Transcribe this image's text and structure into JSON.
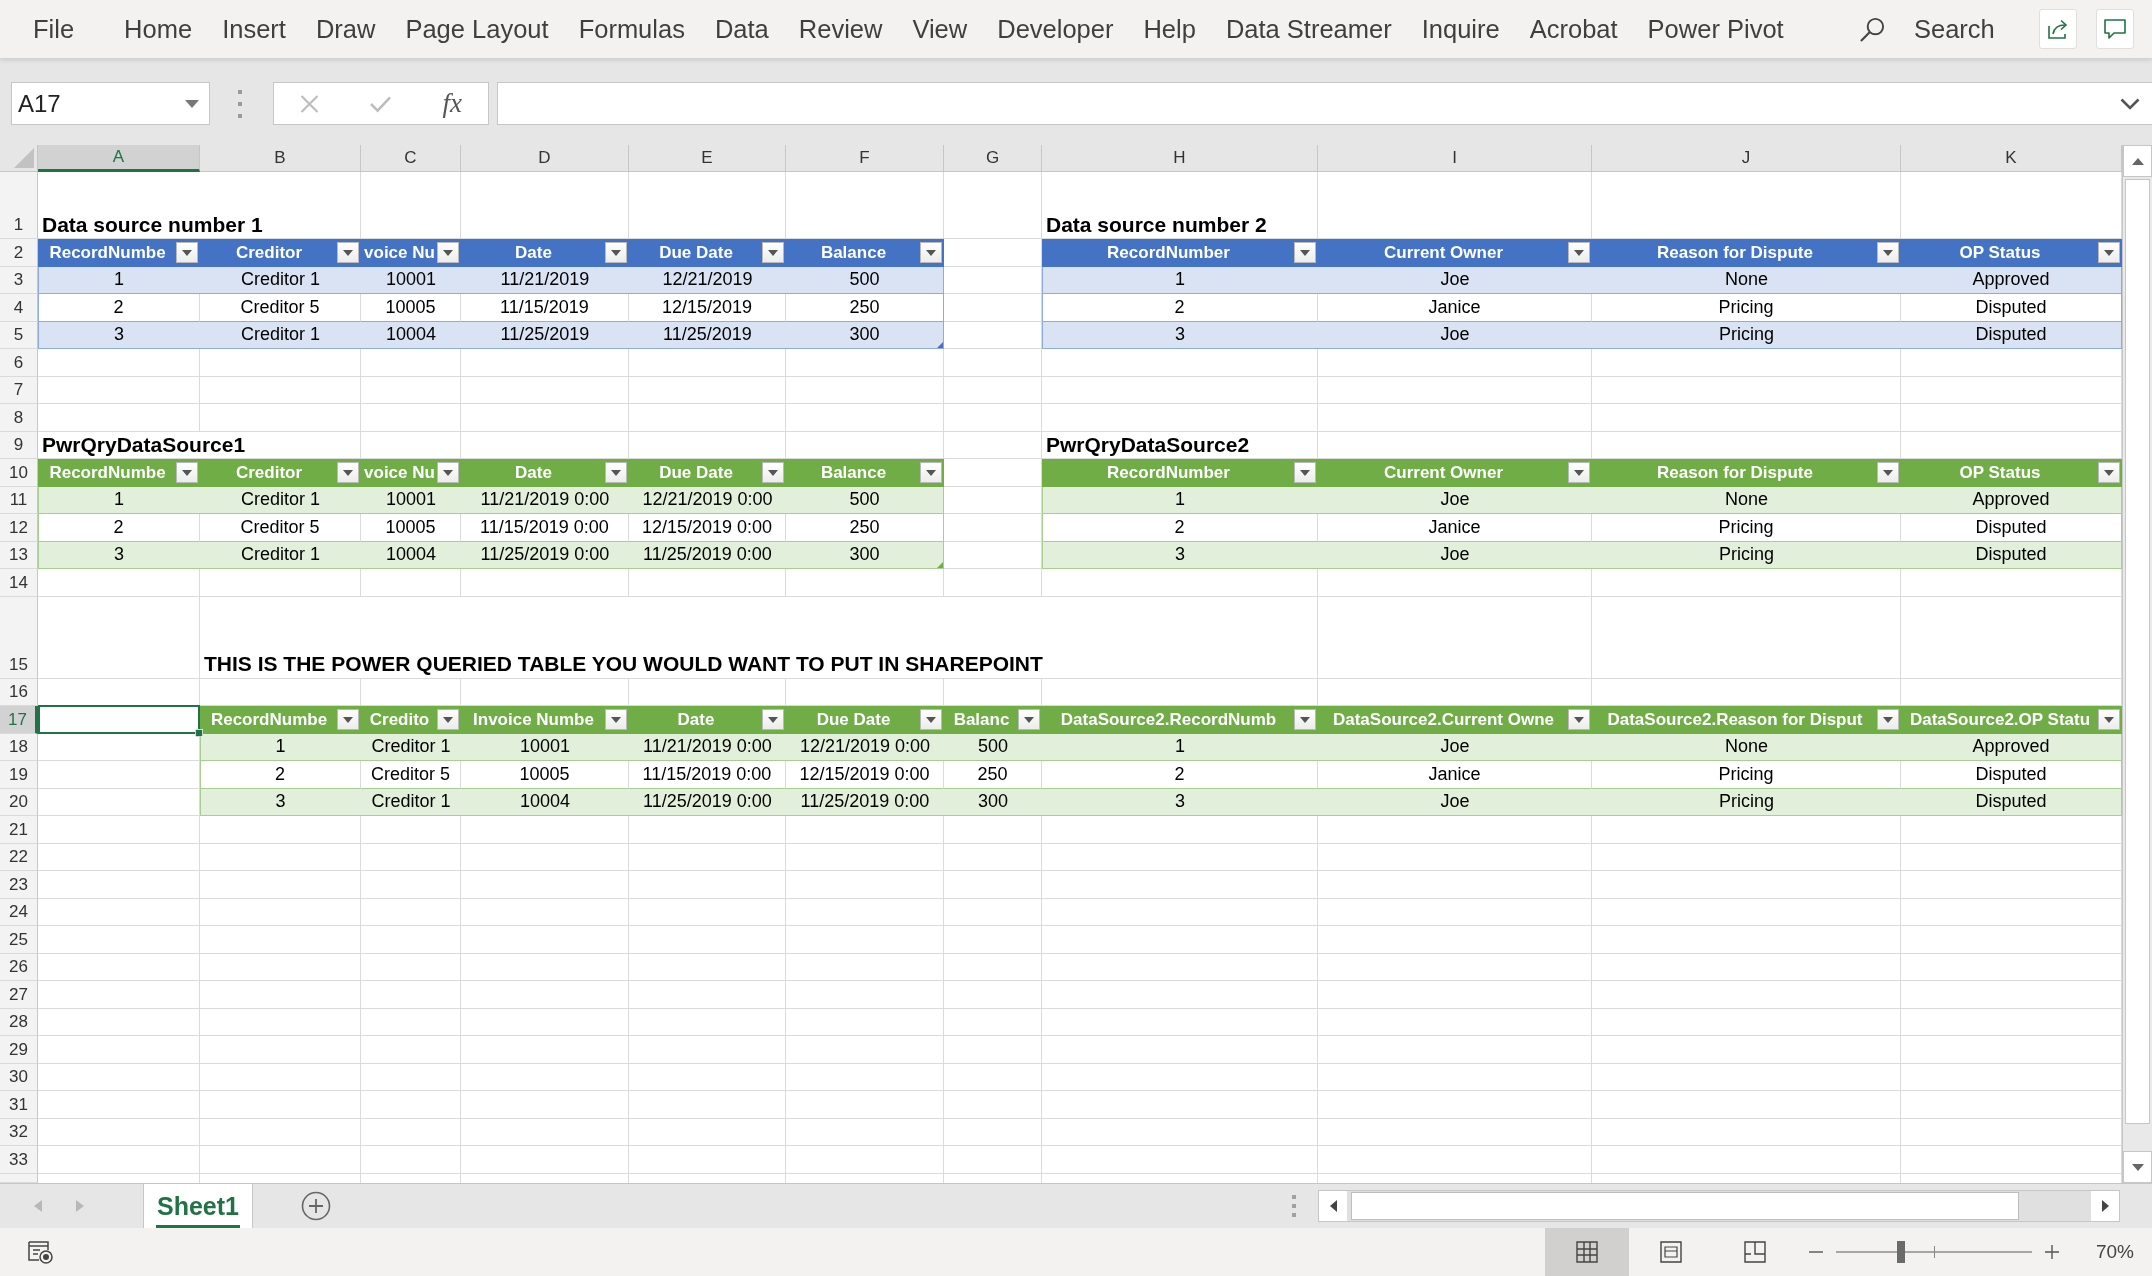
{
  "ribbon": {
    "tabs": [
      {
        "label": "File",
        "selected": false
      },
      {
        "label": "Home",
        "selected": false
      },
      {
        "label": "Insert",
        "selected": false
      },
      {
        "label": "Draw",
        "selected": false
      },
      {
        "label": "Page Layout",
        "selected": false
      },
      {
        "label": "Formulas",
        "selected": false
      },
      {
        "label": "Data",
        "selected": false
      },
      {
        "label": "Review",
        "selected": false
      },
      {
        "label": "View",
        "selected": false
      },
      {
        "label": "Developer",
        "selected": false
      },
      {
        "label": "Help",
        "selected": false
      },
      {
        "label": "Data Streamer",
        "selected": false
      },
      {
        "label": "Inquire",
        "selected": false
      },
      {
        "label": "Acrobat",
        "selected": false
      },
      {
        "label": "Power Pivot",
        "selected": false
      }
    ],
    "search": {
      "placeholder": "Search"
    }
  },
  "formula_bar": {
    "name_box": "A17",
    "function_button": "fx"
  },
  "sheet": {
    "columns": [
      {
        "label": "A",
        "selected": true
      },
      {
        "label": "B",
        "selected": false
      },
      {
        "label": "C",
        "selected": false
      },
      {
        "label": "D",
        "selected": false
      },
      {
        "label": "E",
        "selected": false
      },
      {
        "label": "F",
        "selected": false
      },
      {
        "label": "G",
        "selected": false
      },
      {
        "label": "H",
        "selected": false
      },
      {
        "label": "I",
        "selected": false
      },
      {
        "label": "J",
        "selected": false
      },
      {
        "label": "K",
        "selected": false
      }
    ],
    "rows": [
      {
        "label": "1",
        "selected": false
      },
      {
        "label": "2",
        "selected": false
      },
      {
        "label": "3",
        "selected": false
      },
      {
        "label": "4",
        "selected": false
      },
      {
        "label": "5",
        "selected": false
      },
      {
        "label": "6",
        "selected": false
      },
      {
        "label": "7",
        "selected": false
      },
      {
        "label": "8",
        "selected": false
      },
      {
        "label": "9",
        "selected": false
      },
      {
        "label": "10",
        "selected": false
      },
      {
        "label": "11",
        "selected": false
      },
      {
        "label": "12",
        "selected": false
      },
      {
        "label": "13",
        "selected": false
      },
      {
        "label": "14",
        "selected": false
      },
      {
        "label": "15",
        "selected": false
      },
      {
        "label": "16",
        "selected": false
      },
      {
        "label": "17",
        "selected": true
      },
      {
        "label": "18",
        "selected": false
      },
      {
        "label": "19",
        "selected": false
      },
      {
        "label": "20",
        "selected": false
      },
      {
        "label": "21",
        "selected": false
      },
      {
        "label": "22",
        "selected": false
      },
      {
        "label": "23",
        "selected": false
      },
      {
        "label": "24",
        "selected": false
      },
      {
        "label": "25",
        "selected": false
      },
      {
        "label": "26",
        "selected": false
      },
      {
        "label": "27",
        "selected": false
      },
      {
        "label": "28",
        "selected": false
      },
      {
        "label": "29",
        "selected": false
      },
      {
        "label": "30",
        "selected": false
      },
      {
        "label": "31",
        "selected": false
      },
      {
        "label": "32",
        "selected": false
      },
      {
        "label": "33",
        "selected": false
      }
    ],
    "blocks": [
      {
        "title": "Data source number 1",
        "table": {
          "color": "#4472c4",
          "resize_handle": true,
          "columns": [
            "RecordNumbe",
            "Creditor",
            "voice Nu",
            "Date",
            "Due Date",
            "Balance"
          ],
          "rows": [
            [
              "1",
              "Creditor 1",
              "10001",
              "11/21/2019",
              "12/21/2019",
              "500"
            ],
            [
              "2",
              "Creditor 5",
              "10005",
              "11/15/2019",
              "12/15/2019",
              "250"
            ],
            [
              "3",
              "Creditor 1",
              "10004",
              "11/25/2019",
              "11/25/2019",
              "300"
            ]
          ]
        }
      },
      {
        "title": "Data source number 2",
        "table": {
          "color": "#4472c4",
          "resize_handle": false,
          "columns": [
            "RecordNumber",
            "Current Owner",
            "Reason for Dispute",
            "OP Status"
          ],
          "rows": [
            [
              "1",
              "Joe",
              "None",
              "Approved"
            ],
            [
              "2",
              "Janice",
              "Pricing",
              "Disputed"
            ],
            [
              "3",
              "Joe",
              "Pricing",
              "Disputed"
            ]
          ]
        }
      },
      {
        "title": "PwrQryDataSource1",
        "table": {
          "color": "#70ad47",
          "resize_handle": true,
          "columns": [
            "RecordNumbe",
            "Creditor",
            "voice Nu",
            "Date",
            "Due Date",
            "Balance"
          ],
          "rows": [
            [
              "1",
              "Creditor 1",
              "10001",
              "11/21/2019 0:00",
              "12/21/2019 0:00",
              "500"
            ],
            [
              "2",
              "Creditor 5",
              "10005",
              "11/15/2019 0:00",
              "12/15/2019 0:00",
              "250"
            ],
            [
              "3",
              "Creditor 1",
              "10004",
              "11/25/2019 0:00",
              "11/25/2019 0:00",
              "300"
            ]
          ]
        }
      },
      {
        "title": "PwrQryDataSource2",
        "table": {
          "color": "#70ad47",
          "resize_handle": false,
          "columns": [
            "RecordNumber",
            "Current Owner",
            "Reason for Dispute",
            "OP Status"
          ],
          "rows": [
            [
              "1",
              "Joe",
              "None",
              "Approved"
            ],
            [
              "2",
              "Janice",
              "Pricing",
              "Disputed"
            ],
            [
              "3",
              "Joe",
              "Pricing",
              "Disputed"
            ]
          ]
        }
      },
      {
        "title": "THIS IS THE POWER QUERIED TABLE YOU WOULD WANT TO PUT IN SHAREPOINT",
        "table": {
          "color": "#70ad47",
          "resize_handle": false,
          "columns": [
            "RecordNumbe",
            "Credito",
            "Invoice Numbe",
            "Date",
            "Due Date",
            "Balanc",
            "DataSource2.RecordNumb",
            "DataSource2.Current Owne",
            "DataSource2.Reason for Disput",
            "DataSource2.OP Statu"
          ],
          "rows": [
            [
              "1",
              "Creditor 1",
              "10001",
              "11/21/2019 0:00",
              "12/21/2019 0:00",
              "500",
              "1",
              "Joe",
              "None",
              "Approved"
            ],
            [
              "2",
              "Creditor 5",
              "10005",
              "11/15/2019 0:00",
              "12/15/2019 0:00",
              "250",
              "2",
              "Janice",
              "Pricing",
              "Disputed"
            ],
            [
              "3",
              "Creditor 1",
              "10004",
              "11/25/2019 0:00",
              "11/25/2019 0:00",
              "300",
              "3",
              "Joe",
              "Pricing",
              "Disputed"
            ]
          ]
        }
      }
    ]
  },
  "sheet_tabs": [
    {
      "label": "Sheet1",
      "selected": true
    }
  ],
  "status_bar": {
    "views": [
      {
        "kind": "normal",
        "selected": true
      },
      {
        "kind": "page_layout",
        "selected": false
      },
      {
        "kind": "page_break_preview",
        "selected": false
      }
    ],
    "zoom": {
      "level": 0.33,
      "value": "70%"
    }
  }
}
